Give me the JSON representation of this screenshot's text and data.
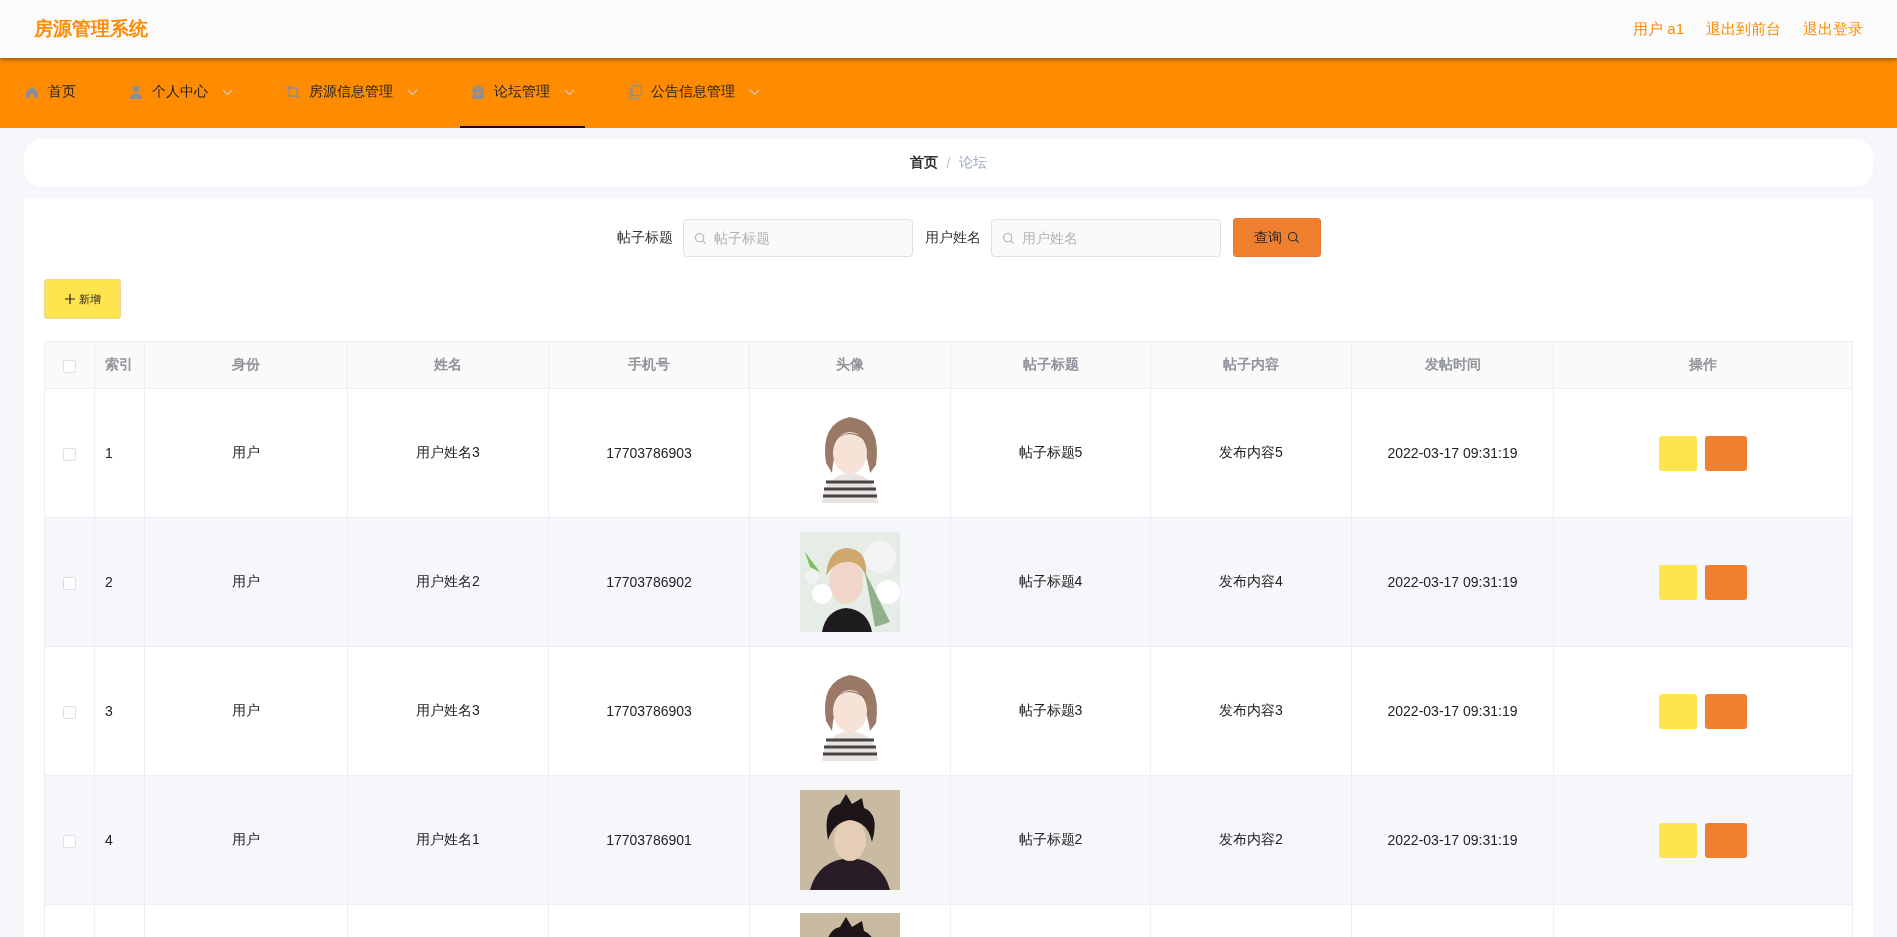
{
  "header": {
    "title": "房源管理系统",
    "links": [
      "用户 a1",
      "退出到前台",
      "退出登录"
    ]
  },
  "nav": [
    {
      "label": "首页",
      "dropdown": false,
      "selected": false
    },
    {
      "label": "个人中心",
      "dropdown": true,
      "selected": false
    },
    {
      "label": "房源信息管理",
      "dropdown": true,
      "selected": false
    },
    {
      "label": "论坛管理",
      "dropdown": true,
      "selected": true
    },
    {
      "label": "公告信息管理",
      "dropdown": true,
      "selected": false
    }
  ],
  "breadcrumb": [
    "首页",
    "/",
    "论坛"
  ],
  "search": [
    {
      "label": "帖子标题",
      "placeholder": "帖子标题"
    },
    {
      "label": "用户姓名",
      "placeholder": "用户姓名"
    }
  ],
  "search_button": "查询",
  "add_button": "新增",
  "table": {
    "select_all_checked": false,
    "columns": [
      "索引",
      "身份",
      "姓名",
      "手机号",
      "头像",
      "帖子标题",
      "帖子内容",
      "发帖时间",
      "操作"
    ],
    "rows": [
      {
        "index": "1",
        "role": "用户",
        "name": "用户姓名3",
        "phone": "17703786903",
        "avatar": {
          "kind": "picture"
        },
        "title": "帖子标题5",
        "content": "发布内容5",
        "time": "2022-03-17 09:31:19",
        "checked": false
      },
      {
        "index": "2",
        "role": "用户",
        "name": "用户姓名2",
        "phone": "17703786902",
        "avatar": {
          "kind": "picture"
        },
        "title": "帖子标题4",
        "content": "发布内容4",
        "time": "2022-03-17 09:31:19",
        "checked": false
      },
      {
        "index": "3",
        "role": "用户",
        "name": "用户姓名3",
        "phone": "17703786903",
        "avatar": {
          "kind": "picture"
        },
        "title": "帖子标题3",
        "content": "发布内容3",
        "time": "2022-03-17 09:31:19",
        "checked": false
      },
      {
        "index": "4",
        "role": "用户",
        "name": "用户姓名1",
        "phone": "17703786901",
        "avatar": {
          "kind": "picture"
        },
        "title": "帖子标题2",
        "content": "发布内容2",
        "time": "2022-03-17 09:31:19",
        "checked": false
      },
      {
        "avatar": {
          "kind": "picture"
        }
      }
    ]
  }
}
